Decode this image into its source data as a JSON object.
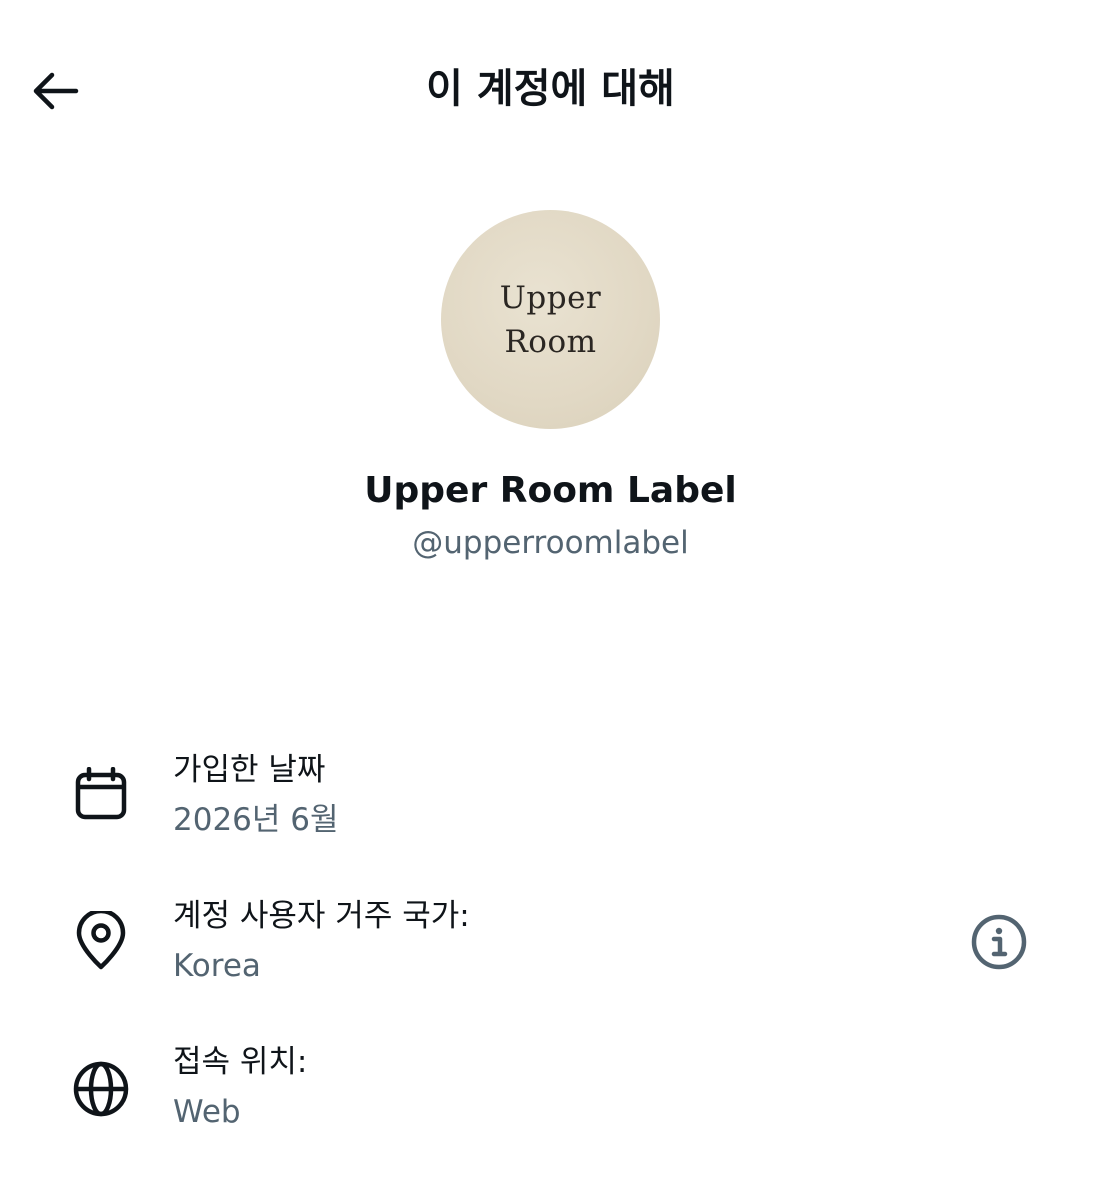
{
  "header": {
    "title": "이 계정에 대해",
    "back_icon": "arrow-left-icon"
  },
  "profile": {
    "avatar_line1": "Upper",
    "avatar_line2": "Room",
    "display_name": "Upper Room Label",
    "handle": "@upperroomlabel"
  },
  "details": {
    "joined": {
      "icon": "calendar-icon",
      "label": "가입한 날짜",
      "value": "2026년 6월"
    },
    "country": {
      "icon": "location-pin-icon",
      "label": "계정 사용자 거주 국가:",
      "value": "Korea",
      "info_icon": "info-icon"
    },
    "connected_via": {
      "icon": "globe-icon",
      "label": "접속 위치:",
      "value": "Web"
    }
  },
  "colors": {
    "primary_text": "#0f1419",
    "secondary_text": "#536471",
    "avatar_bg": "#e1d8c4",
    "background": "#ffffff"
  }
}
